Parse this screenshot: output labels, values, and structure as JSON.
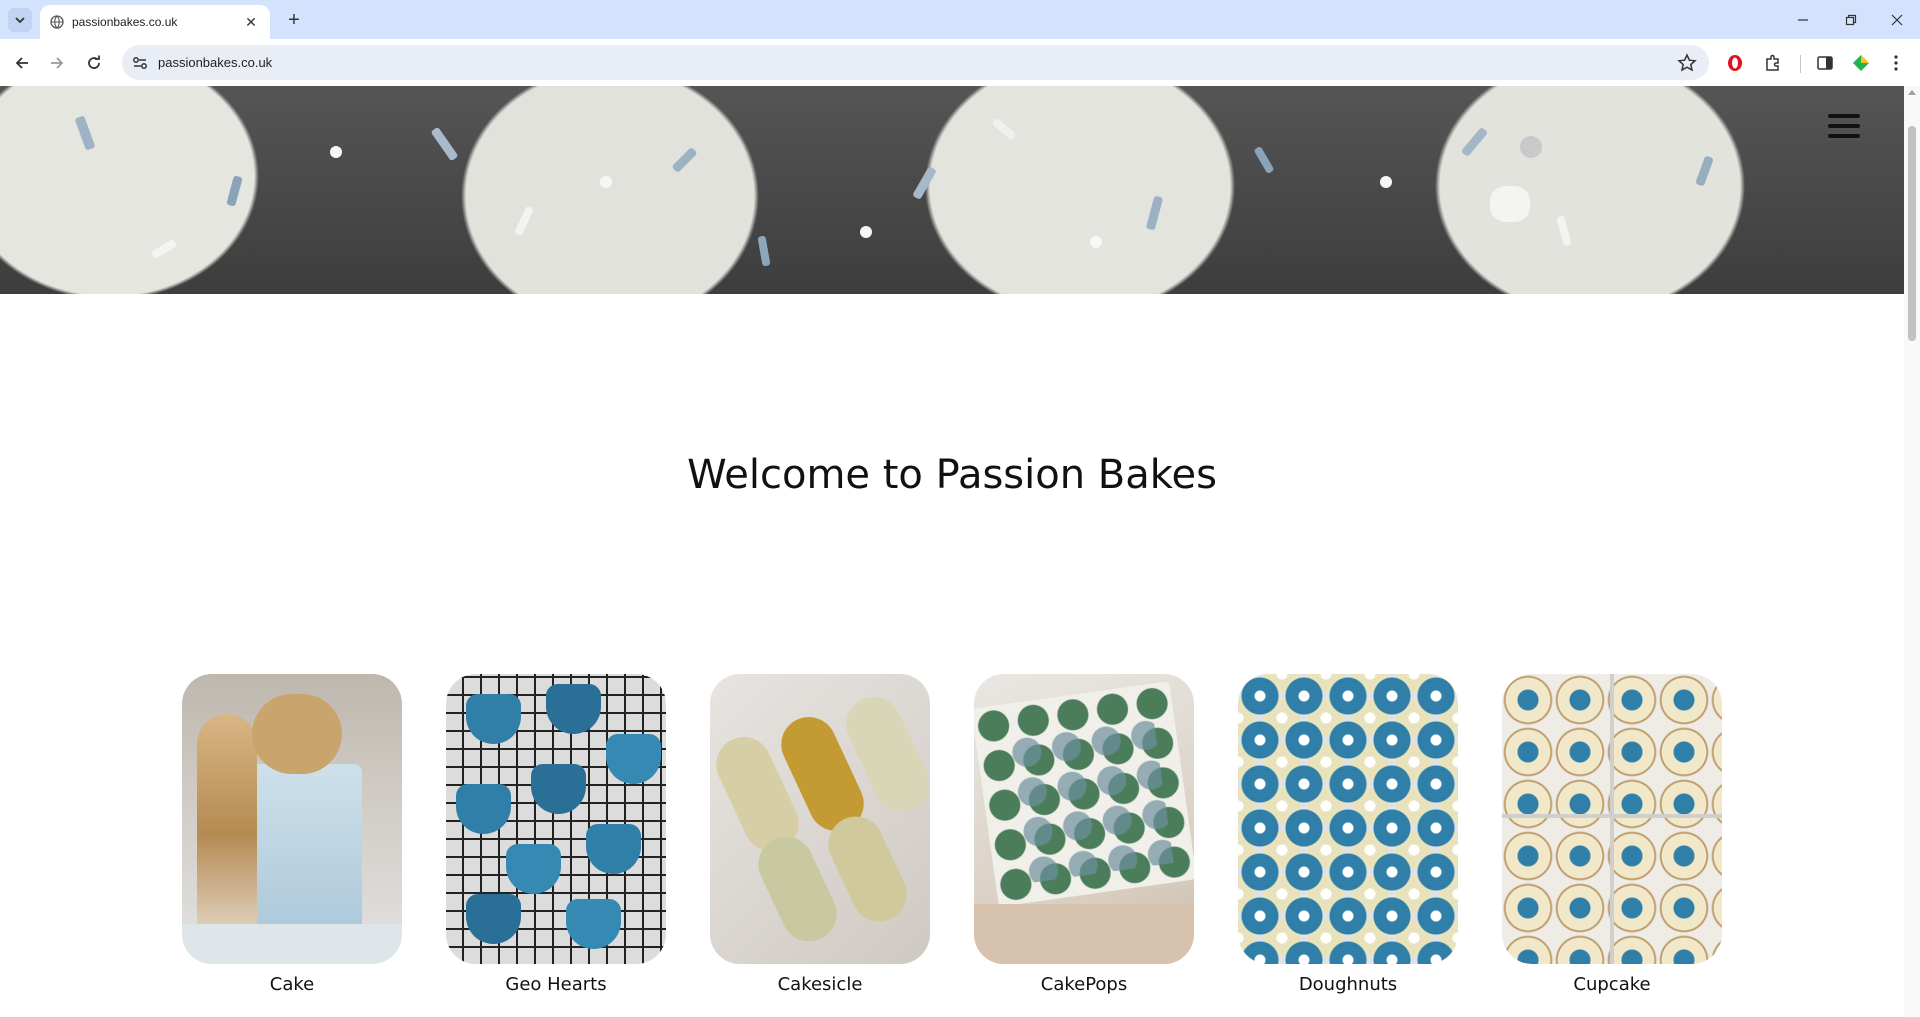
{
  "browser": {
    "tab_title": "passionbakes.co.uk",
    "url": "passionbakes.co.uk"
  },
  "page": {
    "welcome_heading": "Welcome to Passion Bakes",
    "products": [
      {
        "name": "Cake"
      },
      {
        "name": "Geo Hearts"
      },
      {
        "name": "Cakesicle"
      },
      {
        "name": "CakePops"
      },
      {
        "name": "Doughnuts"
      },
      {
        "name": "Cupcake"
      }
    ]
  },
  "colors": {
    "tabstrip": "#d3e3fd",
    "accent_blue": "#2f7fa8",
    "text": "#111111"
  }
}
